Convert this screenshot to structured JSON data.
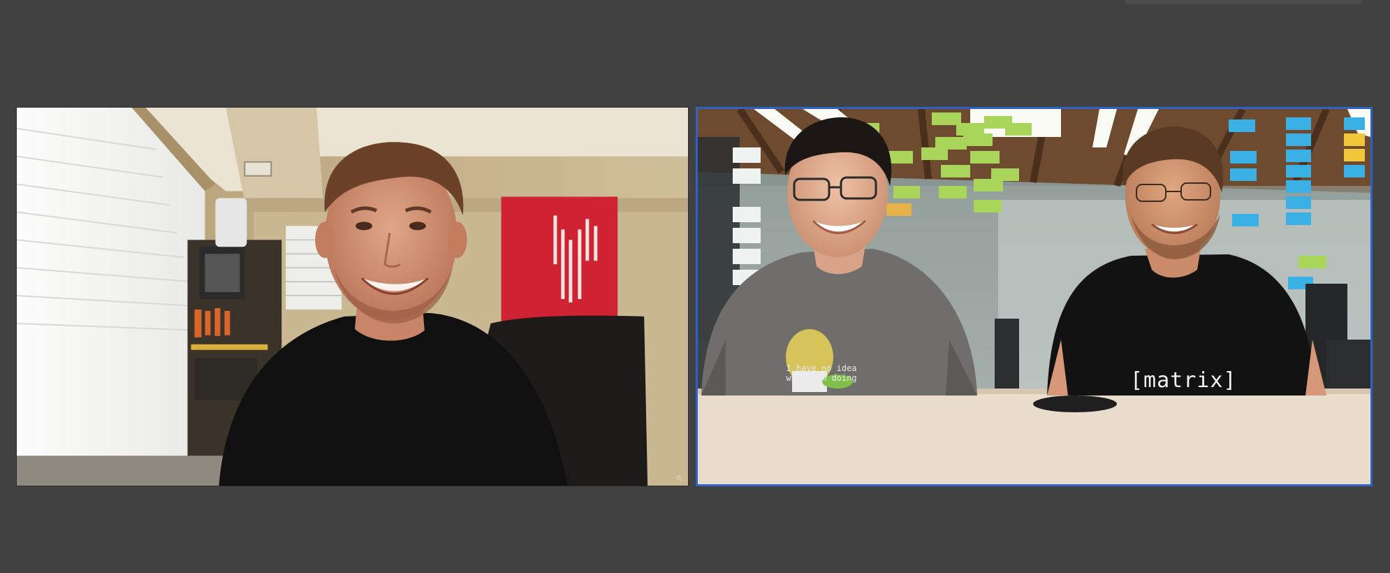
{
  "call": {
    "participants": [
      {
        "id": "participant-1",
        "tile_menu_icon": "more-vertical-icon",
        "tile_badge_icon": "star-icon",
        "active_speaker": false
      },
      {
        "id": "participant-2",
        "active_speaker": true,
        "shirt_texts": {
          "matrix": "[matrix]",
          "slogan": "I have no idea what I'm doing"
        }
      }
    ],
    "colors": {
      "background": "#414141",
      "active_speaker_border": "#2f62c8"
    },
    "glyphs": {
      "menu": "⋮",
      "star": "☆"
    }
  }
}
